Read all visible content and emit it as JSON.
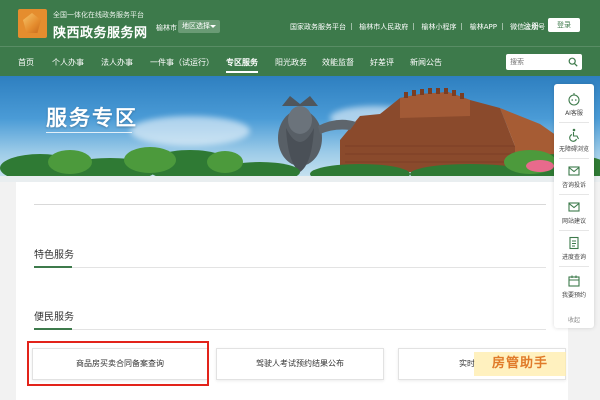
{
  "header": {
    "subtitle": "全国一体化在线政务服务平台",
    "title": "陕西政务服务网",
    "city": "榆林市",
    "region_button": "地区选择",
    "links": [
      "国家政务服务平台",
      "榆林市人民政府",
      "榆林小程序",
      "榆林APP",
      "微信公众号"
    ],
    "register": "注册",
    "login": "登录"
  },
  "nav": {
    "items": [
      "首页",
      "个人办事",
      "法人办事",
      "一件事（试运行）",
      "专区服务",
      "阳光政务",
      "效能监督",
      "好差评",
      "新闻公告"
    ],
    "active": "专区服务",
    "search_placeholder": "搜索"
  },
  "banner": {
    "title": "服务专区"
  },
  "side_panel": {
    "items": [
      "AI客服",
      "无障碍浏览",
      "咨询投诉",
      "网站建议",
      "进度查询",
      "我要预约"
    ],
    "collapse": "收起"
  },
  "sections": {
    "special": "特色服务",
    "convenience": "便民服务"
  },
  "services": [
    "商品房买卖合同备案查询",
    "驾驶人考试预约结果公布",
    "实时"
  ],
  "watermark": "房管助手",
  "colors": {
    "brand_green": "#3d7a4b",
    "logo_orange": "#e58d2e",
    "highlight_red": "#e2231a"
  }
}
